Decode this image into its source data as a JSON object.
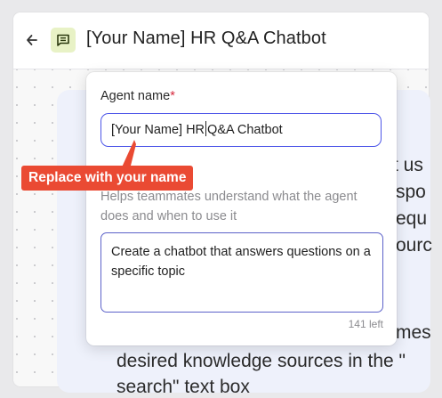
{
  "header": {
    "back_icon": "back-arrow-icon",
    "app_icon": "chat-message-icon",
    "app_icon_bg": "#e8f2c6",
    "title": "[Your Name] HR Q&A Chatbot"
  },
  "background_text": {
    "line1": "t us",
    "line2": "spo",
    "line3": "equ",
    "line4": "ourc",
    "line5": "mes",
    "line6": "desired knowledge sources in the \"",
    "line7": "search\" text box"
  },
  "form": {
    "agent_name_label": "Agent name",
    "required_mark": "*",
    "agent_name_before_caret": "[Your Name] HR",
    "agent_name_after_caret": "Q&A Chatbot",
    "description_helper": "Helps teammates understand what the agent does and when to use it",
    "description_value": "Create a chatbot that answers questions on a specific topic",
    "char_counter": "141 left",
    "accent_color": "#4d56e8"
  },
  "callout": {
    "text": "Replace with your name",
    "color": "#ea4a33"
  }
}
